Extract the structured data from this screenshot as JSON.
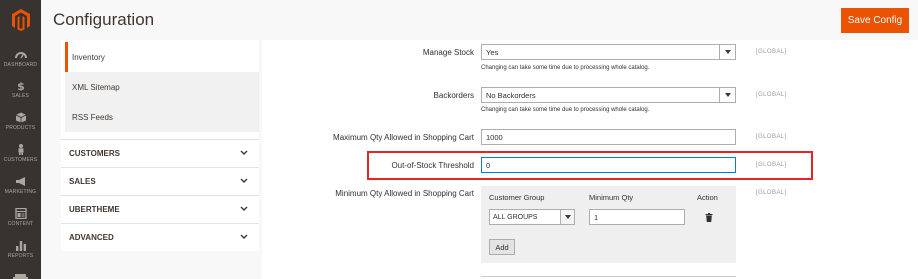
{
  "nav": {
    "items": [
      {
        "label": "DASHBOARD",
        "icon": "dashboard-icon"
      },
      {
        "label": "SALES",
        "icon": "dollar-icon"
      },
      {
        "label": "PRODUCTS",
        "icon": "box-icon"
      },
      {
        "label": "CUSTOMERS",
        "icon": "person-icon"
      },
      {
        "label": "MARKETING",
        "icon": "megaphone-icon"
      },
      {
        "label": "CONTENT",
        "icon": "layout-icon"
      },
      {
        "label": "REPORTS",
        "icon": "bar-chart-icon"
      }
    ]
  },
  "header": {
    "title": "Configuration",
    "save_label": "Save Config"
  },
  "tabs": {
    "sub_items": [
      "Inventory",
      "XML Sitemap",
      "RSS Feeds"
    ],
    "groups": [
      "CUSTOMERS",
      "SALES",
      "UBERTHEME",
      "ADVANCED"
    ]
  },
  "form": {
    "manage_stock": {
      "label": "Manage Stock",
      "value": "Yes",
      "note": "Changing can take some time due to processing whole catalog.",
      "scope": "[GLOBAL]"
    },
    "backorders": {
      "label": "Backorders",
      "value": "No Backorders",
      "note": "Changing can take some time due to processing whole catalog.",
      "scope": "[GLOBAL]"
    },
    "max_qty": {
      "label": "Maximum Qty Allowed in Shopping Cart",
      "value": "1000",
      "scope": "[GLOBAL]"
    },
    "oos_threshold": {
      "label": "Out-of-Stock Threshold",
      "value": "0",
      "scope": "[GLOBAL]"
    },
    "min_qty": {
      "label": "Minimum Qty Allowed in Shopping Cart",
      "scope": "[GLOBAL]",
      "col_group": "Customer Group",
      "col_qty": "Minimum Qty",
      "col_action": "Action",
      "group_value": "ALL GROUPS",
      "qty_value": "1",
      "add_label": "Add"
    }
  },
  "colors": {
    "accent": "#eb5202",
    "nav_bg": "#373330",
    "highlight": "#e22626"
  }
}
